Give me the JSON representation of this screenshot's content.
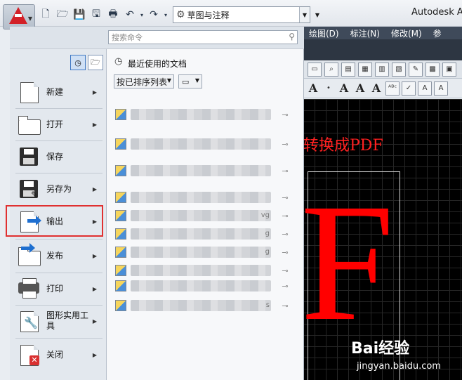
{
  "window": {
    "app_title": "Autodesk Au",
    "workspace": "草图与注释"
  },
  "ribbon": {
    "tabs": [
      "绘图(D)",
      "标注(N)",
      "修改(M)",
      "参"
    ]
  },
  "canvas": {
    "text": "转换成PDF",
    "big_letter": "F",
    "text_color": "#ff2020"
  },
  "watermark": {
    "brand": "Bai经验",
    "url": "jingyan.baidu.com"
  },
  "menu": {
    "search_placeholder": "搜索命令",
    "items": [
      {
        "label": "新建",
        "icon": "new-document-icon",
        "has_submenu": true
      },
      {
        "label": "打开",
        "icon": "open-folder-icon",
        "has_submenu": true
      },
      {
        "label": "保存",
        "icon": "save-icon",
        "has_submenu": false
      },
      {
        "label": "另存为",
        "icon": "save-as-icon",
        "has_submenu": true
      },
      {
        "label": "输出",
        "icon": "export-icon",
        "has_submenu": true,
        "highlighted": true
      },
      {
        "label": "发布",
        "icon": "publish-icon",
        "has_submenu": true
      },
      {
        "label": "打印",
        "icon": "printer-icon",
        "has_submenu": true
      },
      {
        "label": "图形实用工具",
        "icon": "drawing-utilities-icon",
        "has_submenu": true
      },
      {
        "label": "关闭",
        "icon": "close-document-icon",
        "has_submenu": true
      }
    ],
    "recent": {
      "title": "最近使用的文档",
      "sort_label": "按已排序列表",
      "files": [
        {
          "suffix": ""
        },
        {
          "suffix": ""
        },
        {
          "suffix": ""
        },
        {
          "suffix": ""
        },
        {
          "suffix": "vg"
        },
        {
          "suffix": "g"
        },
        {
          "suffix": "g"
        },
        {
          "suffix": ""
        },
        {
          "suffix": ""
        },
        {
          "suffix": "s"
        }
      ]
    }
  },
  "highlight_color": "#e03030"
}
